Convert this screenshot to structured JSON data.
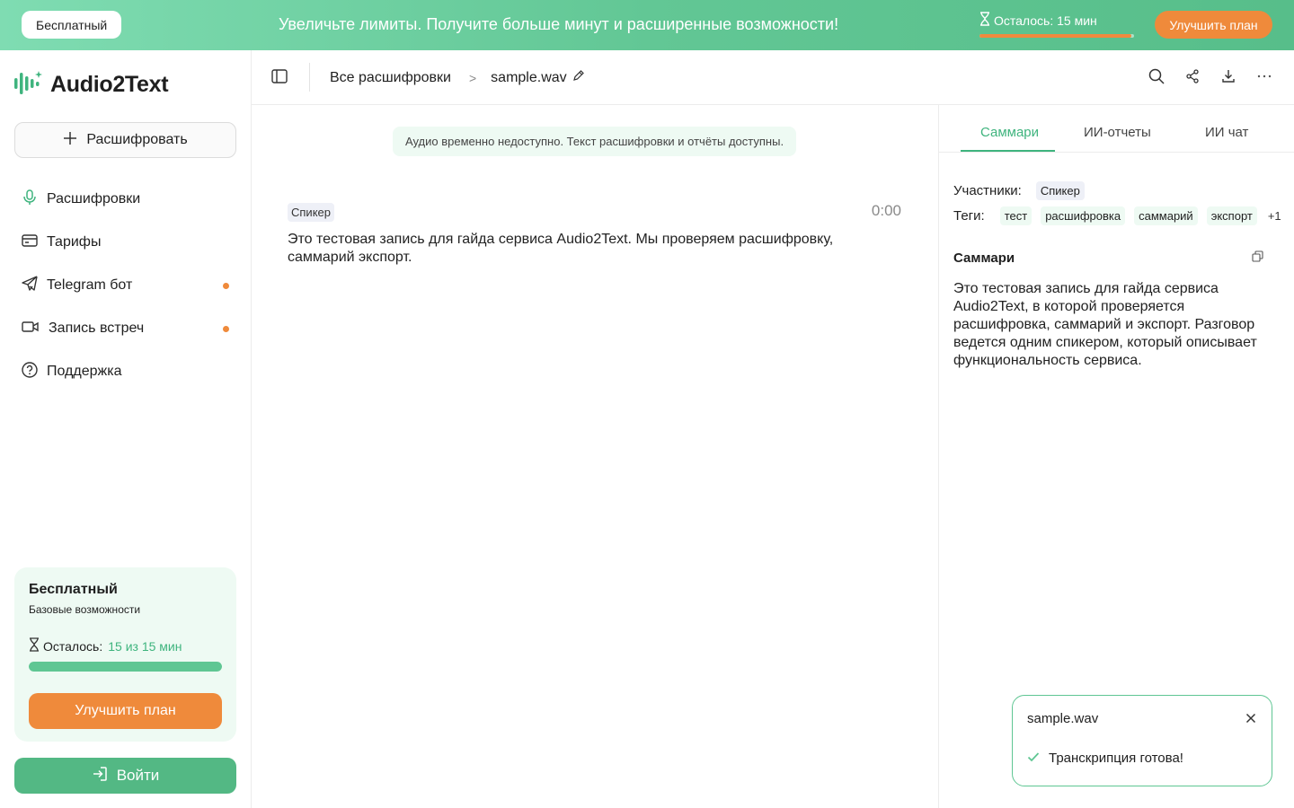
{
  "banner": {
    "plan_label": "Бесплатный",
    "message": "Увеличьте лимиты. Получите больше минут и расширенные возможности!",
    "remaining_label": "Осталось: 15 мин",
    "remaining_fraction": 0.98,
    "upgrade_label": "Улучшить план"
  },
  "sidebar": {
    "brand": "Audio2Text",
    "transcribe_label": "Расшифровать",
    "items": [
      {
        "label": "Расшифровки",
        "icon": "microphone-icon",
        "dot": false
      },
      {
        "label": "Тарифы",
        "icon": "credit-card-icon",
        "dot": false
      },
      {
        "label": "Telegram бот",
        "icon": "telegram-icon",
        "dot": true
      },
      {
        "label": "Запись встреч",
        "icon": "video-camera-icon",
        "dot": true
      },
      {
        "label": "Поддержка",
        "icon": "help-circle-icon",
        "dot": false
      }
    ],
    "plan_card": {
      "name": "Бесплатный",
      "description": "Базовые возможности",
      "remaining_prefix": "Осталось:",
      "remaining_value": "15 из 15 мин",
      "remaining_fraction": 1.0,
      "upgrade_label": "Улучшить план"
    },
    "login_label": "Войти"
  },
  "header": {
    "breadcrumb_root": "Все расшифровки",
    "breadcrumb_separator": ">",
    "file_name": "sample.wav"
  },
  "transcript": {
    "notice": "Аудио временно недоступно. Текст расшифровки и отчёты доступны.",
    "segments": [
      {
        "speaker": "Спикер",
        "time": "0:00",
        "text": "Это тестовая запись для гайда сервиса Audio2Text. Мы проверяем расшифровку, саммарий экспорт."
      }
    ]
  },
  "panel": {
    "tabs": [
      "Саммари",
      "ИИ-отчеты",
      "ИИ чат"
    ],
    "active_tab": "Саммари",
    "participants_label": "Участники:",
    "participants": [
      "Спикер"
    ],
    "tags_label": "Теги:",
    "tags": [
      "тест",
      "расшифровка",
      "саммарий",
      "экспорт"
    ],
    "tags_more": "+1",
    "summary_title": "Саммари",
    "summary_text": "Это тестовая запись для гайда сервиса Audio2Text, в которой проверяется расшифровка, саммарий и экспорт. Разговор ведется одним спикером, который описывает функциональность сервиса."
  },
  "toast": {
    "file_name": "sample.wav",
    "status": "Транскрипция готова!"
  },
  "colors": {
    "accent_green": "#3fb47e",
    "accent_orange": "#ef8a3b"
  }
}
